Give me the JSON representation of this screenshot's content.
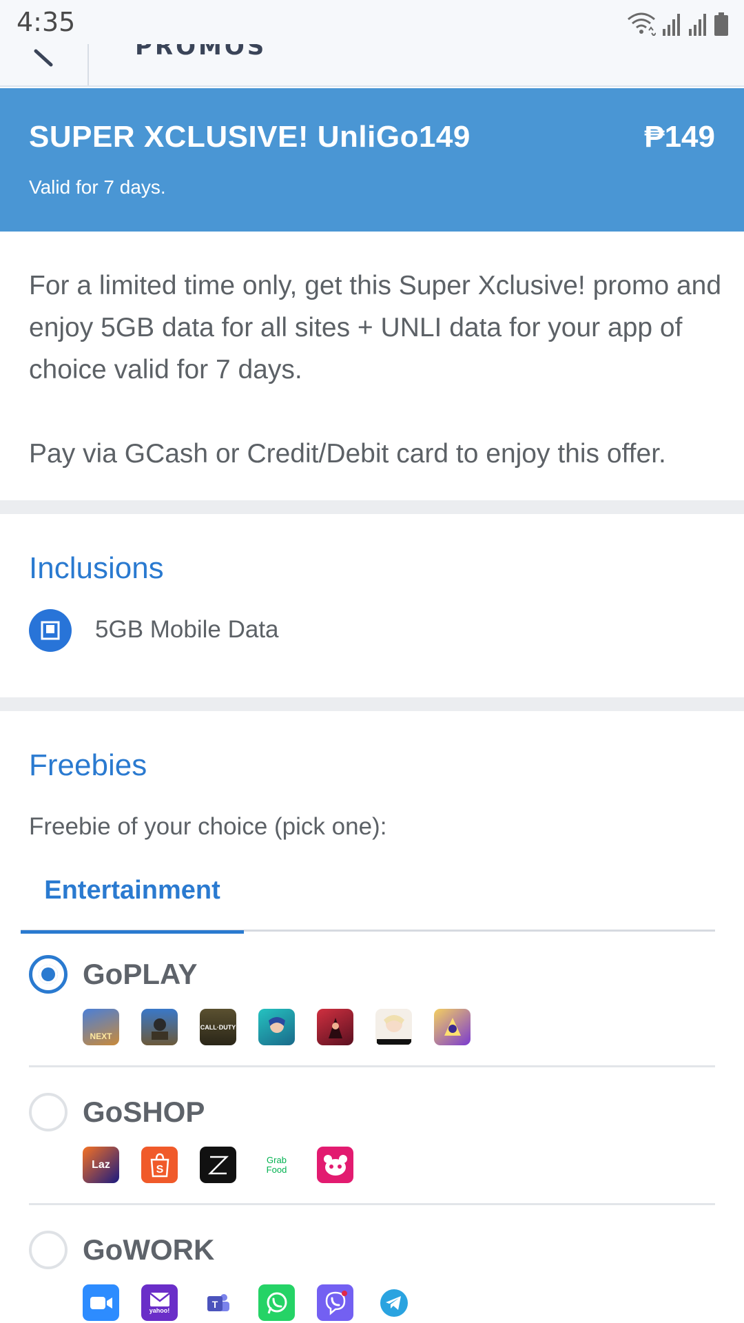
{
  "status_bar": {
    "time": "4:35"
  },
  "nav": {
    "title": "PROMOS"
  },
  "banner": {
    "title": "SUPER XCLUSIVE! UnliGo149",
    "price": "₱149",
    "validity": "Valid for 7 days."
  },
  "description": {
    "paragraph1": "For a limited time only, get this Super Xclusive! promo and enjoy 5GB data for all sites + UNLI data for your app of choice valid for 7 days.",
    "paragraph2": "Pay via GCash or Credit/Debit card to enjoy this offer."
  },
  "inclusions": {
    "title": "Inclusions",
    "items": [
      {
        "label": "5GB Mobile Data",
        "icon": "data-icon"
      }
    ]
  },
  "freebies": {
    "title": "Freebies",
    "intro": "Freebie of your choice (pick one):",
    "tabs": [
      {
        "label": "Entertainment",
        "active": true
      }
    ],
    "options": [
      {
        "name": "GoPLAY",
        "selected": true,
        "apps": [
          "mobile-legends-icon",
          "pubg-icon",
          "call-of-duty-icon",
          "league-wild-rift-icon",
          "free-fire-icon",
          "genshin-impact-icon",
          "game-app-icon"
        ]
      },
      {
        "name": "GoSHOP",
        "selected": false,
        "apps": [
          "lazada-icon",
          "shopee-icon",
          "zalora-icon",
          "grabfood-icon",
          "foodpanda-icon"
        ]
      },
      {
        "name": "GoWORK",
        "selected": false,
        "apps": [
          "zoom-icon",
          "yahoo-mail-icon",
          "teams-icon",
          "whatsapp-icon",
          "viber-icon",
          "telegram-icon"
        ]
      }
    ]
  },
  "app_labels": {
    "lazada": "Laz",
    "grabfood_top": "Grab",
    "grabfood_bottom": "Food",
    "yahoo": "yahoo!",
    "cod": "CALL·DUTY",
    "ml": "NEXT"
  },
  "colors": {
    "banner_bg": "#4a96d4",
    "accent": "#2a7ad0",
    "separator": "#ebedf0"
  }
}
